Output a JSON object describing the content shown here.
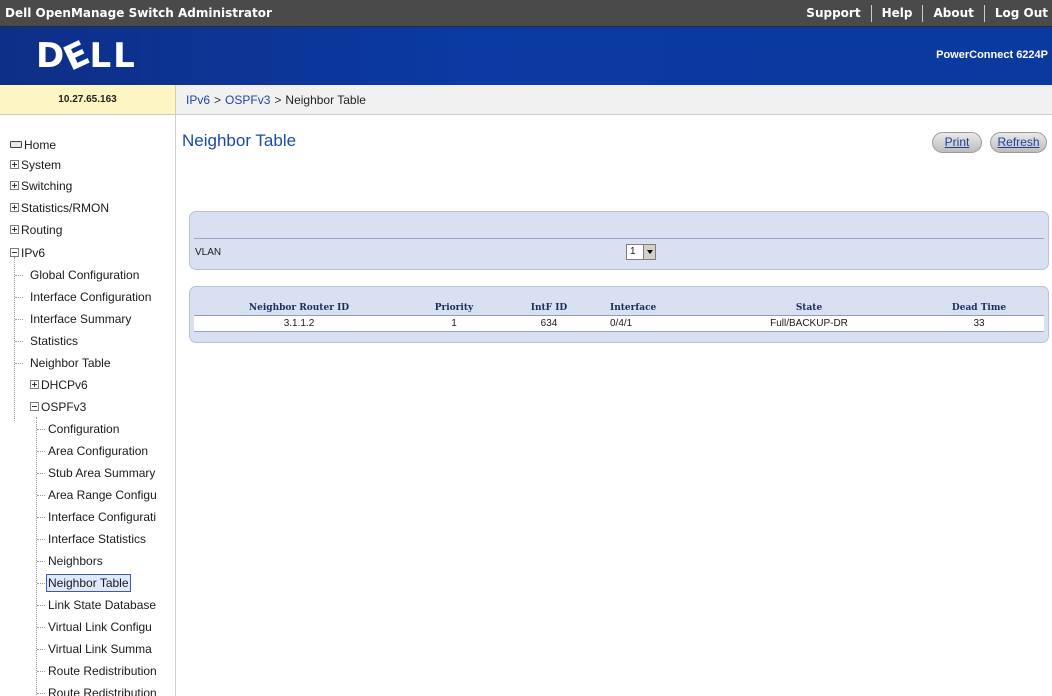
{
  "header": {
    "app_title": "Dell OpenManage Switch Administrator",
    "links": [
      "Support",
      "Help",
      "About",
      "Log Out"
    ],
    "logo_text": "DELL",
    "model": "PowerConnect 6224P"
  },
  "ip_address": "10.27.65.163",
  "breadcrumb": {
    "part1": "IPv6",
    "sep": ">",
    "part2": "OSPFv3",
    "current": "Neighbor Table"
  },
  "sidebar": {
    "home": "Home",
    "system": "System",
    "switching": "Switching",
    "statistics": "Statistics/RMON",
    "routing": "Routing",
    "ipv6": "IPv6",
    "global_config": "Global Configuration",
    "interface_config": "Interface Configuration",
    "interface_summary": "Interface Summary",
    "statistics_item": "Statistics",
    "neighbor_table_ipv6": "Neighbor Table",
    "dhcpv6": "DHCPv6",
    "ospfv3": "OSPFv3",
    "ospf_items": [
      "Configuration",
      "Area Configuration",
      "Stub Area Summary",
      "Area Range Configu",
      "Interface Configurati",
      "Interface Statistics",
      "Neighbors",
      "Neighbor Table",
      "Link State Database",
      "Virtual Link Configu",
      "Virtual Link Summa",
      "Route Redistribution",
      "Route Redistribution"
    ]
  },
  "main": {
    "title": "Neighbor Table",
    "print_label": "Print",
    "refresh_label": "Refresh",
    "vlan_label": "VLAN",
    "vlan_value": "1",
    "table": {
      "headers": [
        "Neighbor Router ID",
        "Priority",
        "IntF ID",
        "Interface",
        "State",
        "Dead Time"
      ],
      "rows": [
        [
          "3.1.1.2",
          "1",
          "634",
          "0/4/1",
          "Full/BACKUP-DR",
          "33"
        ]
      ]
    }
  }
}
